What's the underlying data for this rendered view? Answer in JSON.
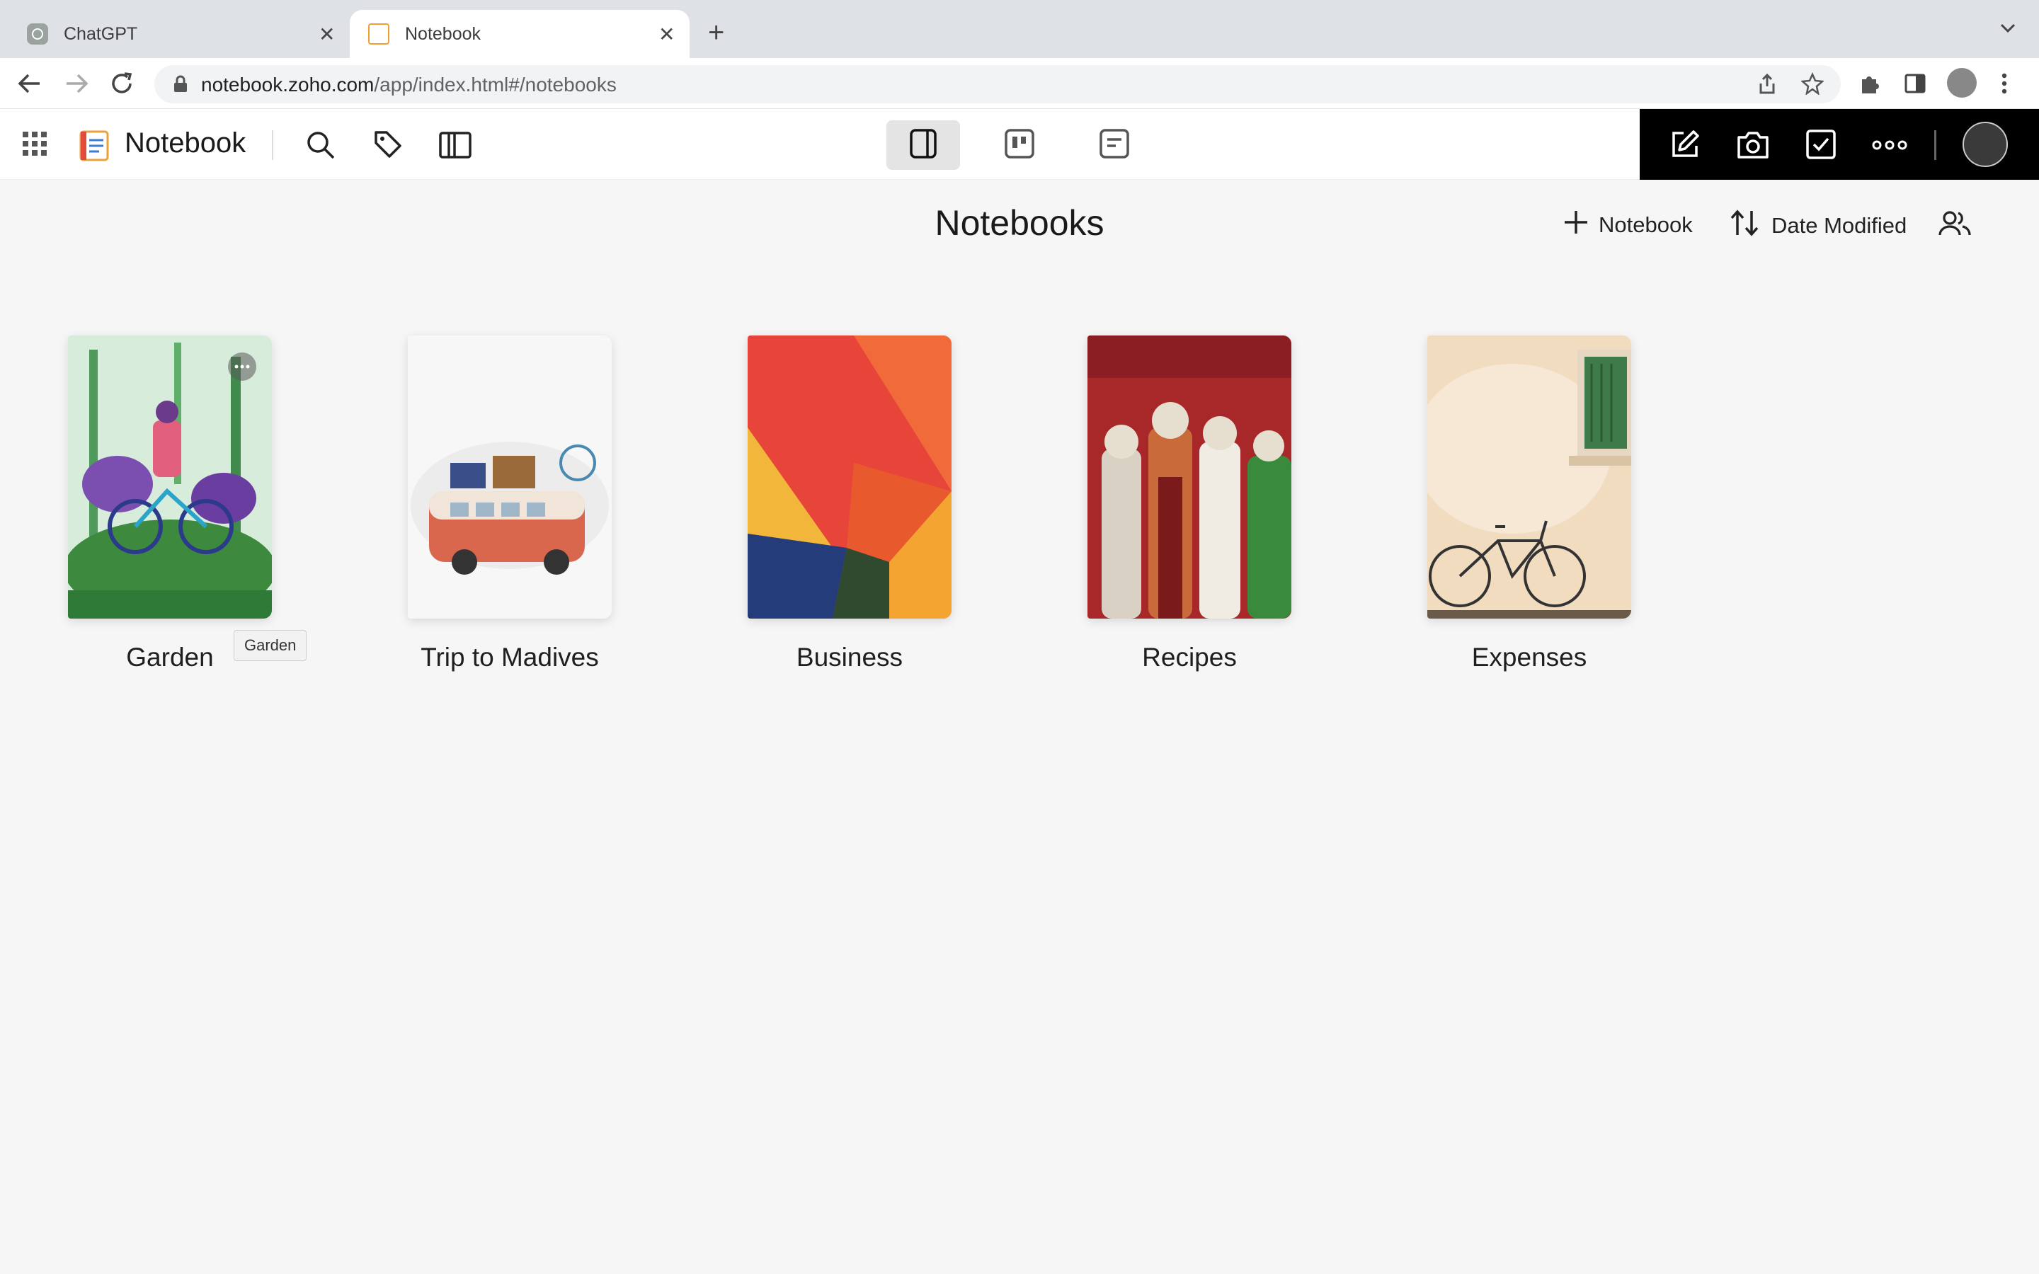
{
  "browser": {
    "tabs": [
      {
        "label": "ChatGPT",
        "active": false
      },
      {
        "label": "Notebook",
        "active": true
      }
    ],
    "url_host": "notebook.zoho.com",
    "url_path": "/app/index.html#/notebooks"
  },
  "app": {
    "name": "Notebook",
    "title": "Notebooks",
    "add_label": "Notebook",
    "sort_label": "Date Modified"
  },
  "notebooks": [
    {
      "title": "Garden",
      "cover": "garden-illustration"
    },
    {
      "title": "Trip to Madives",
      "cover": "van-illustration"
    },
    {
      "title": "Business",
      "cover": "abstract-paint"
    },
    {
      "title": "Recipes",
      "cover": "puppets"
    },
    {
      "title": "Expenses",
      "cover": "bicycle-wall"
    }
  ],
  "tooltip": "Garden",
  "colors": {
    "tabstrip": "#dee1e6",
    "page_bg": "#f6f6f6",
    "dark_panel": "#000000",
    "active_view": "#e4e4e4"
  }
}
